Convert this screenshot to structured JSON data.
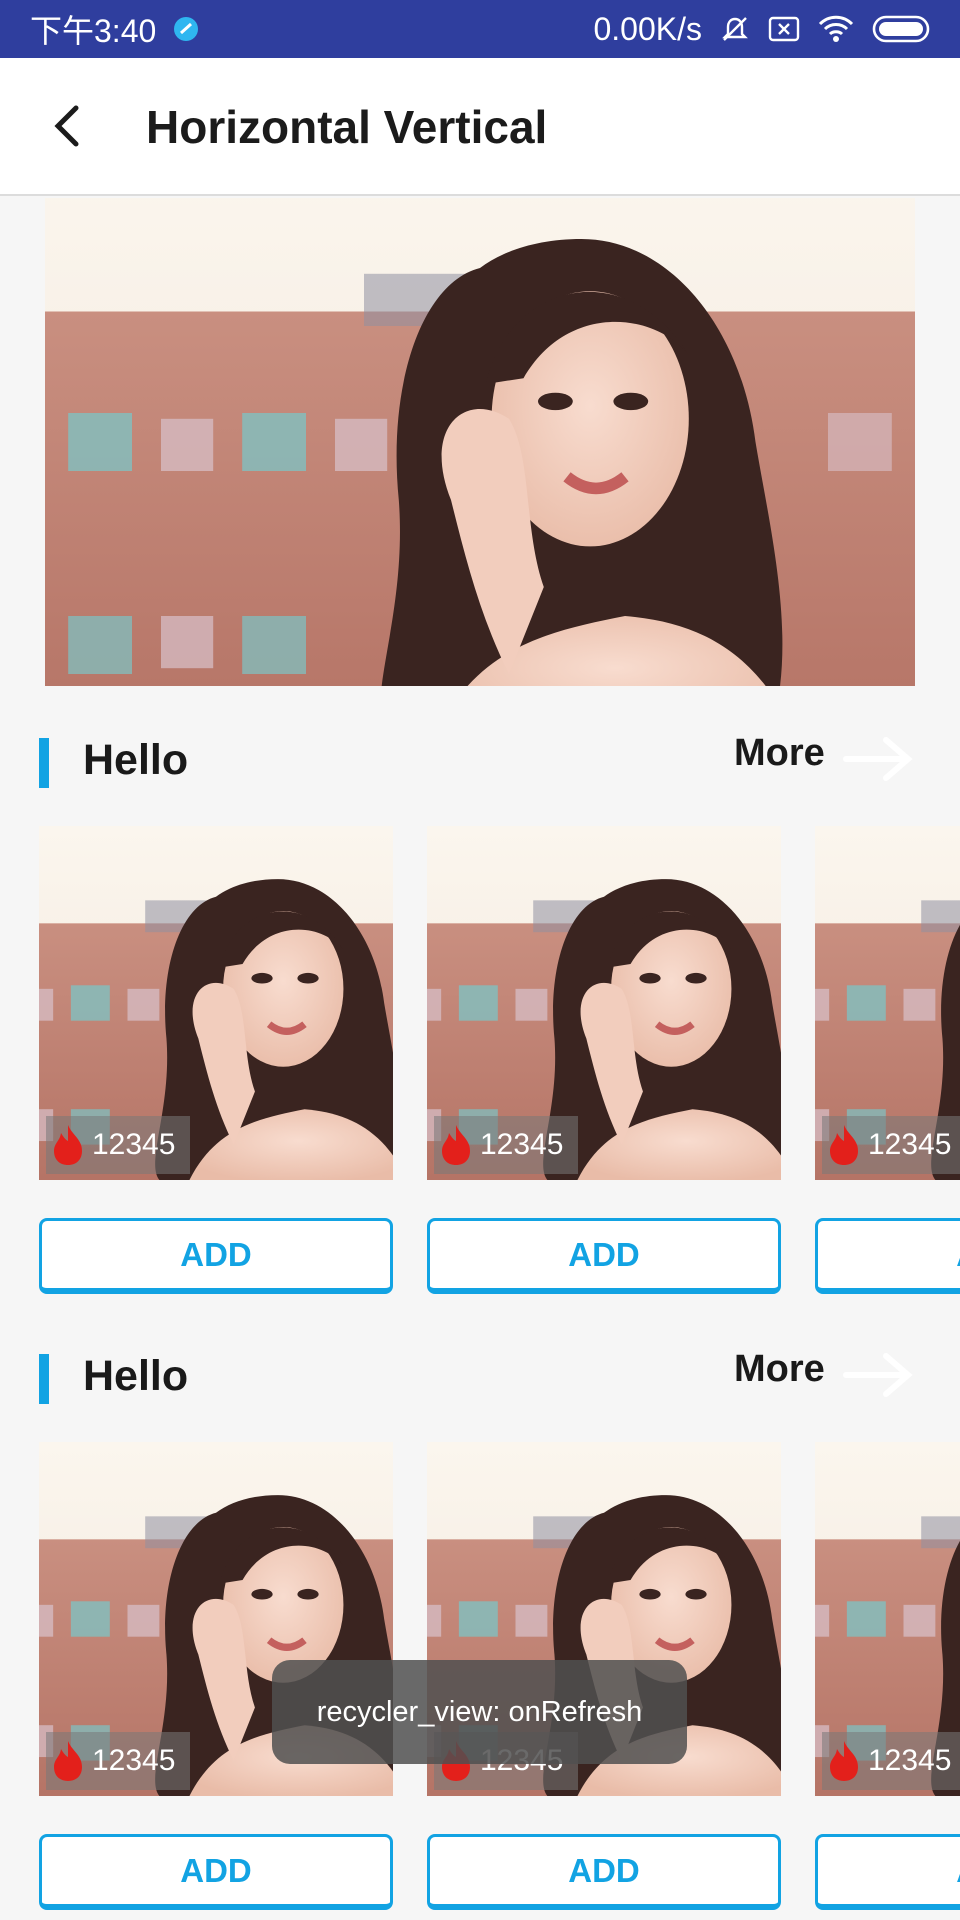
{
  "status_bar": {
    "time": "下午3:40",
    "speed": "0.00K/s",
    "icons": [
      "app-notification-icon",
      "mute-icon",
      "no-sim-icon",
      "wifi-icon",
      "battery-icon"
    ]
  },
  "app_bar": {
    "title": "Horizontal Vertical",
    "back_icon": "chevron-left-icon"
  },
  "sections": [
    {
      "title": "Hello",
      "more_label": "More",
      "cards": [
        {
          "count": "12345",
          "button": "ADD"
        },
        {
          "count": "12345",
          "button": "ADD"
        },
        {
          "count": "12345",
          "button": "ADD"
        }
      ]
    },
    {
      "title": "Hello",
      "more_label": "More",
      "cards": [
        {
          "count": "12345",
          "button": "ADD"
        },
        {
          "count": "12345",
          "button": "ADD"
        },
        {
          "count": "12345",
          "button": "ADD"
        }
      ]
    }
  ],
  "toast": "recycler_view: onRefresh",
  "colors": {
    "status_bar": "#2f3e9e",
    "accent": "#12a3e3",
    "fire": "#e3201b"
  }
}
